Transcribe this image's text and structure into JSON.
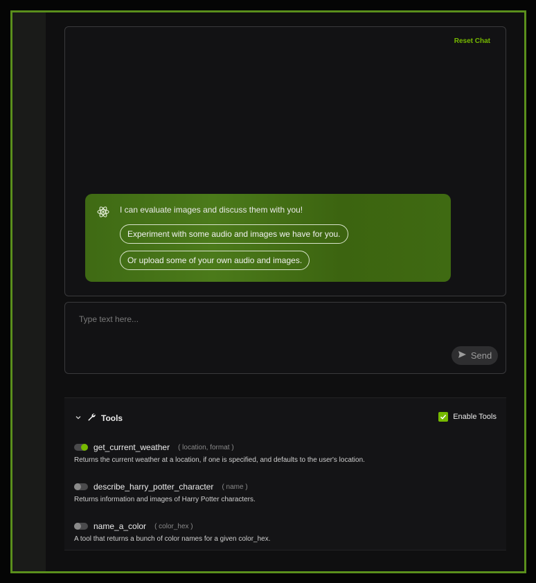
{
  "chat": {
    "reset_label": "Reset Chat",
    "assistant_message": "I can evaluate images and discuss them with you!",
    "suggestions": [
      {
        "label": "Experiment with some audio and images we have for you."
      },
      {
        "label": "Or upload some of your own audio and images."
      }
    ]
  },
  "input": {
    "placeholder": "Type text here...",
    "send_label": "Send"
  },
  "tools": {
    "title": "Tools",
    "enable_label": "Enable Tools",
    "enabled": true,
    "items": [
      {
        "name": "get_current_weather",
        "params": "( location, format )",
        "description": "Returns the current weather at a location, if one is specified, and defaults to the user's location.",
        "enabled": true
      },
      {
        "name": "describe_harry_potter_character",
        "params": "( name )",
        "description": "Returns information and images of Harry Potter characters.",
        "enabled": false
      },
      {
        "name": "name_a_color",
        "params": "( color_hex )",
        "description": "A tool that returns a bunch of color names for a given color_hex.",
        "enabled": false
      }
    ]
  },
  "colors": {
    "accent": "#76b900",
    "frame_border": "#5a8f1c",
    "bubble": "#4b7a1a"
  },
  "icons": {
    "assistant": "atom-icon",
    "send": "send-arrow-icon",
    "collapse": "chevron-down-icon",
    "tools": "wrench-icon",
    "check": "check-icon"
  }
}
